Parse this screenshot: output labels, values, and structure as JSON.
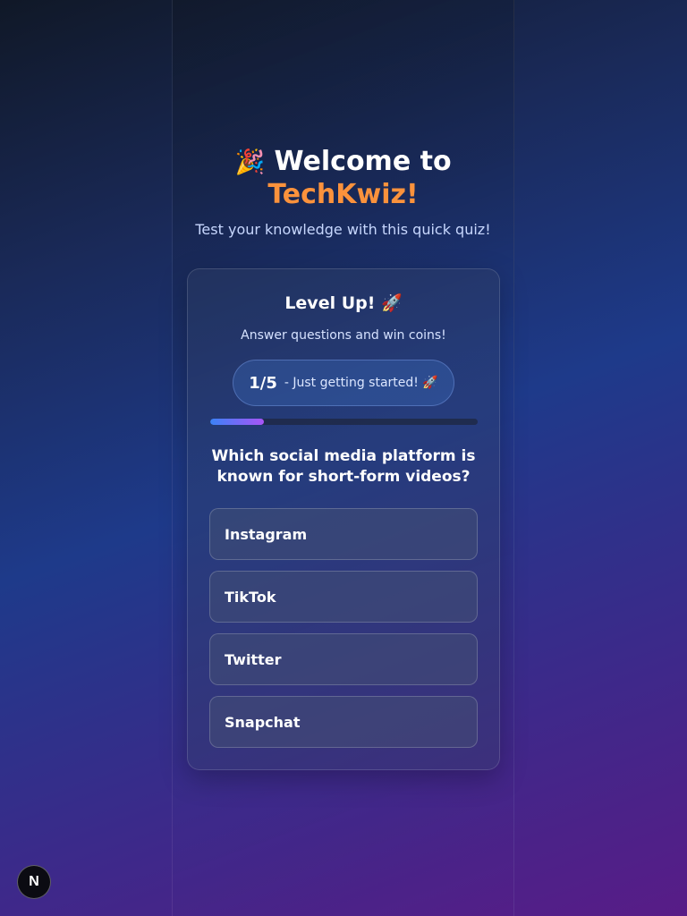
{
  "hero": {
    "emoji": "🎉",
    "title_prefix": "Welcome to",
    "brand": "TechKwiz!",
    "subtitle": "Test your knowledge with this quick quiz!"
  },
  "card": {
    "title": "Level Up! 🚀",
    "subtitle": "Answer questions and win coins!",
    "progress": {
      "count": "1/5",
      "message": "- Just getting started! 🚀",
      "fraction": 0.2
    },
    "question": "Which social media platform is known for short-form videos?",
    "options": [
      "Instagram",
      "TikTok",
      "Twitter",
      "Snapchat"
    ]
  },
  "badge": {
    "label": "N",
    "icon": "nextjs-icon"
  },
  "colors": {
    "accent": "#fb923c",
    "progress_start": "#3b82f6",
    "progress_end": "#a855f7"
  }
}
